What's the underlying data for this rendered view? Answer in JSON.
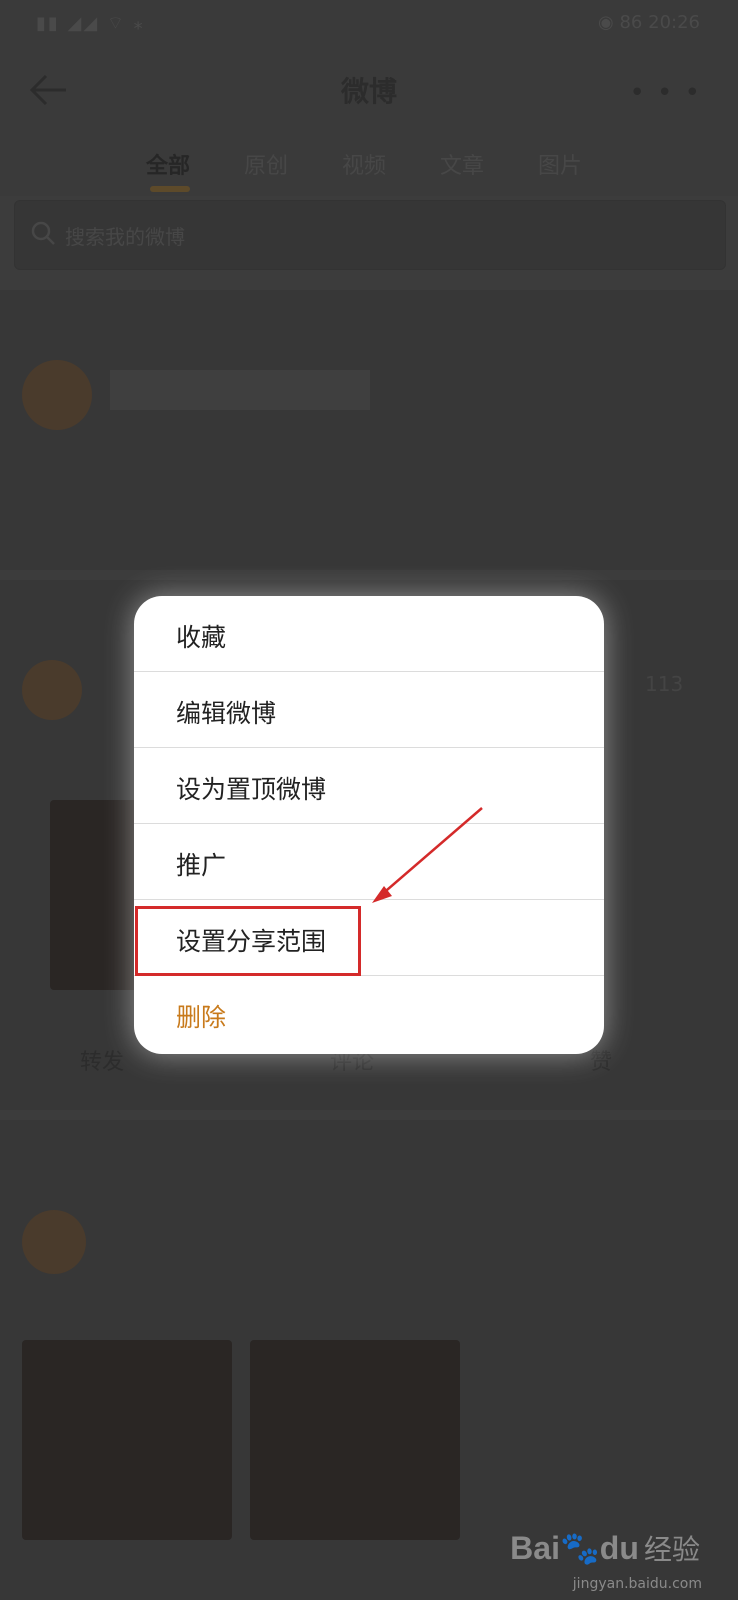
{
  "status_bar": {
    "time": "20:26",
    "battery": "86"
  },
  "nav": {
    "title": "微博"
  },
  "tabs": [
    {
      "label": "全部"
    },
    {
      "label": "原创"
    },
    {
      "label": "视频"
    },
    {
      "label": "文章"
    },
    {
      "label": "图片"
    }
  ],
  "search": {
    "placeholder": "搜索我的微博"
  },
  "background_card": {
    "count": "113",
    "actions": {
      "repost": "转发",
      "comment": "评论",
      "like": "赞"
    }
  },
  "menu": {
    "items": [
      {
        "label": "收藏"
      },
      {
        "label": "编辑微博"
      },
      {
        "label": "设为置顶微博"
      },
      {
        "label": "推广"
      },
      {
        "label": "设置分享范围"
      },
      {
        "label": "删除"
      }
    ]
  },
  "colors": {
    "delete": "#c87a1b",
    "annotation": "#d42a2a",
    "accent": "#f39c12"
  },
  "watermark": {
    "logo": "Bai",
    "logo_suffix": "du",
    "text": "经验",
    "url": "jingyan.baidu.com"
  }
}
